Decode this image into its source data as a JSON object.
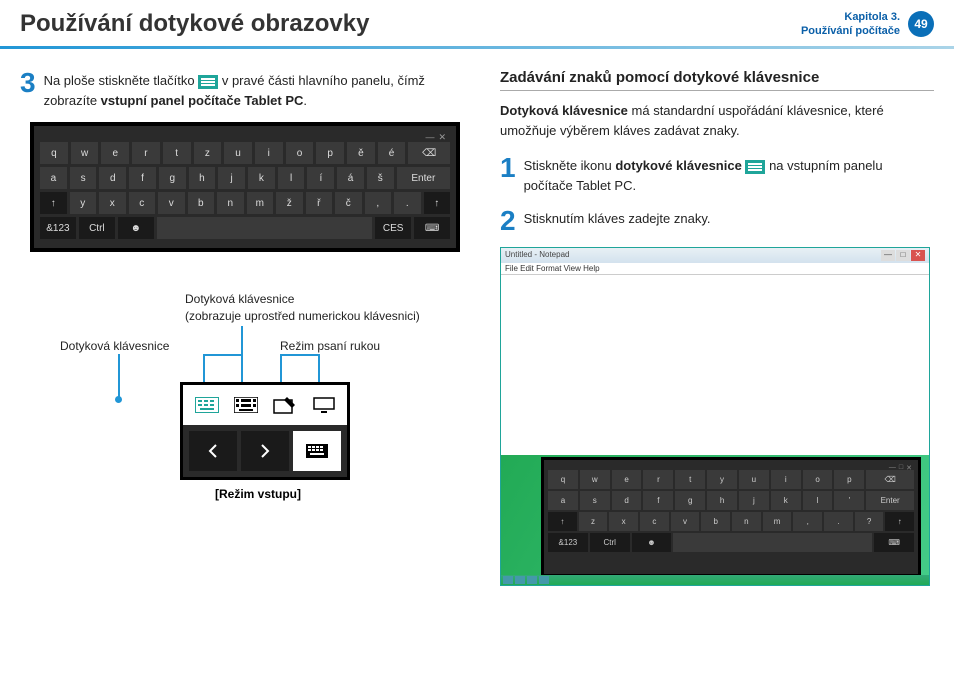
{
  "header": {
    "title": "Používání dotykové obrazovky",
    "chapter_line1": "Kapitola 3.",
    "chapter_line2": "Používání počítače",
    "page": "49"
  },
  "left": {
    "step3_num": "3",
    "step3_a": "Na ploše stiskněte tlačítko ",
    "step3_b": " v pravé části hlavního panelu, čímž zobrazíte ",
    "step3_bold": "vstupní panel počítače Tablet PC",
    "step3_end": ".",
    "kb_rows": [
      [
        "q",
        "w",
        "e",
        "r",
        "t",
        "z",
        "u",
        "i",
        "o",
        "p",
        "ě",
        "é",
        "⌫"
      ],
      [
        "a",
        "s",
        "d",
        "f",
        "g",
        "h",
        "j",
        "k",
        "l",
        "í",
        "á",
        "š",
        "Enter"
      ],
      [
        "↑",
        "y",
        "x",
        "c",
        "v",
        "b",
        "n",
        "m",
        "ž",
        "ř",
        "č",
        ",",
        ".",
        "↑"
      ],
      [
        "&123",
        "Ctrl",
        "☻",
        "",
        "",
        "",
        "",
        "",
        "",
        "",
        "CES",
        "⌨"
      ]
    ],
    "label_a": "Dotyková klávesnice",
    "label_b": "(zobrazuje uprostřed numerickou klávesnici)",
    "label_c": "Dotyková klávesnice",
    "label_d": "Režim psaní rukou",
    "caption": "[Režim vstupu]"
  },
  "right": {
    "subhead": "Zadávání znaků pomocí dotykové klávesnice",
    "para_bold": "Dotyková klávesnice",
    "para_text": " má standardní uspořádání klávesnice, které umožňuje výběrem kláves zadávat znaky.",
    "step1_num": "1",
    "step1_a": "Stiskněte ikonu ",
    "step1_bold": "dotykové klávesnice",
    "step1_b": " na vstupním panelu počítače Tablet PC.",
    "step2_num": "2",
    "step2_text": "Stisknutím kláves zadejte znaky.",
    "notepad_title": "Untitled - Notepad",
    "notepad_menu": "File  Edit  Format  View  Help",
    "ss_kb_rows": [
      [
        "q",
        "w",
        "e",
        "r",
        "t",
        "y",
        "u",
        "i",
        "o",
        "p",
        "⌫"
      ],
      [
        "a",
        "s",
        "d",
        "f",
        "g",
        "h",
        "j",
        "k",
        "l",
        "'",
        "Enter"
      ],
      [
        "↑",
        "z",
        "x",
        "c",
        "v",
        "b",
        "n",
        "m",
        ",",
        ".",
        "?",
        "↑"
      ],
      [
        "&123",
        "Ctrl",
        "☻",
        "",
        "",
        "",
        "",
        "",
        "",
        "⌨"
      ]
    ]
  }
}
